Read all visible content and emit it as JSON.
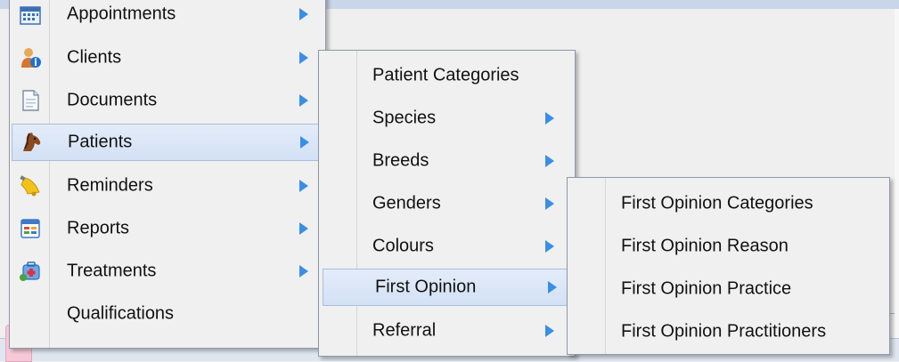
{
  "main_menu": {
    "items": [
      {
        "label": "Appointments",
        "icon": "calendar-icon",
        "has_submenu": true
      },
      {
        "label": "Clients",
        "icon": "client-info-icon",
        "has_submenu": true
      },
      {
        "label": "Documents",
        "icon": "document-icon",
        "has_submenu": true
      },
      {
        "label": "Patients",
        "icon": "horse-icon",
        "has_submenu": true,
        "active": true
      },
      {
        "label": "Reminders",
        "icon": "bell-icon",
        "has_submenu": true
      },
      {
        "label": "Reports",
        "icon": "report-icon",
        "has_submenu": true
      },
      {
        "label": "Treatments",
        "icon": "first-aid-kit-icon",
        "has_submenu": true
      },
      {
        "label": "Qualifications",
        "icon": "",
        "has_submenu": false
      }
    ]
  },
  "patients_submenu": {
    "items": [
      {
        "label": "Patient Categories",
        "has_submenu": false
      },
      {
        "label": "Species",
        "has_submenu": true
      },
      {
        "label": "Breeds",
        "has_submenu": true
      },
      {
        "label": "Genders",
        "has_submenu": true
      },
      {
        "label": "Colours",
        "has_submenu": true
      },
      {
        "label": "First Opinion",
        "has_submenu": true,
        "active": true
      },
      {
        "label": "Referral",
        "has_submenu": true
      }
    ]
  },
  "first_opinion_submenu": {
    "items": [
      {
        "label": "First Opinion Categories"
      },
      {
        "label": "First Opinion Reason"
      },
      {
        "label": "First Opinion Practice"
      },
      {
        "label": "First Opinion Practitioners"
      }
    ]
  },
  "colors": {
    "arrow": "#3a8ee6",
    "highlight": "#d8e4f5",
    "menu_bg": "#f0f0f0"
  }
}
